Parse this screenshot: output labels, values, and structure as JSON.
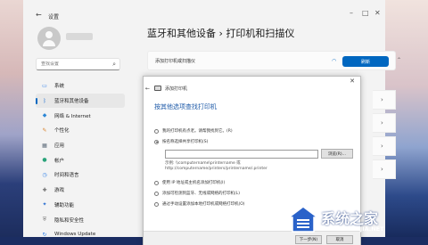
{
  "settings": {
    "window_title": "设置",
    "search_placeholder": "查找设置",
    "page_title": "蓝牙和其他设备  ›  打印机和扫描仪",
    "add_printer_label": "添加打印机或扫描仪",
    "refresh_label": "刷新"
  },
  "nav": {
    "items": [
      {
        "label": "系统",
        "icon": "monitor-icon",
        "color": "#2b7de9"
      },
      {
        "label": "蓝牙和其他设备",
        "icon": "bluetooth-icon",
        "color": "#1f6fd1"
      },
      {
        "label": "网络 & Internet",
        "icon": "network-icon",
        "color": "#2c87d6"
      },
      {
        "label": "个性化",
        "icon": "brush-icon",
        "color": "#d9822b"
      },
      {
        "label": "应用",
        "icon": "apps-icon",
        "color": "#5d6b7a"
      },
      {
        "label": "帐户",
        "icon": "account-icon",
        "color": "#2aa37a"
      },
      {
        "label": "时间和语言",
        "icon": "clock-globe-icon",
        "color": "#2b7de9"
      },
      {
        "label": "游戏",
        "icon": "gamepad-icon",
        "color": "#6b6b6b"
      },
      {
        "label": "辅助功能",
        "icon": "accessibility-icon",
        "color": "#2b6fd1"
      },
      {
        "label": "隐私和安全性",
        "icon": "shield-icon",
        "color": "#7a7a7a"
      },
      {
        "label": "Windows Update",
        "icon": "update-icon",
        "color": "#2b7de9"
      }
    ]
  },
  "dialog": {
    "title": "添加打印机",
    "heading": "按其他选项查找打印机",
    "options": [
      "我的打印机有点老。请帮我找到它。(R)",
      "按名称选择共享打印机(S)",
      "使用 IP 地址或主机名添加打印机(I)",
      "添加可检测到蓝牙、无线或网络的打印机(L)",
      "通过手动设置添加本地打印机或网络打印机(O)"
    ],
    "selected_index": 1,
    "browse_label": "浏览(R)...",
    "example_line1": "示例: \\\\computername\\printername 或",
    "example_line2": "http://computername/printers/printername/.printer",
    "next_label": "下一步(N)",
    "cancel_label": "取消"
  },
  "watermark": {
    "title": "系统之家",
    "url": "XITONGZHIJIA.NET"
  }
}
